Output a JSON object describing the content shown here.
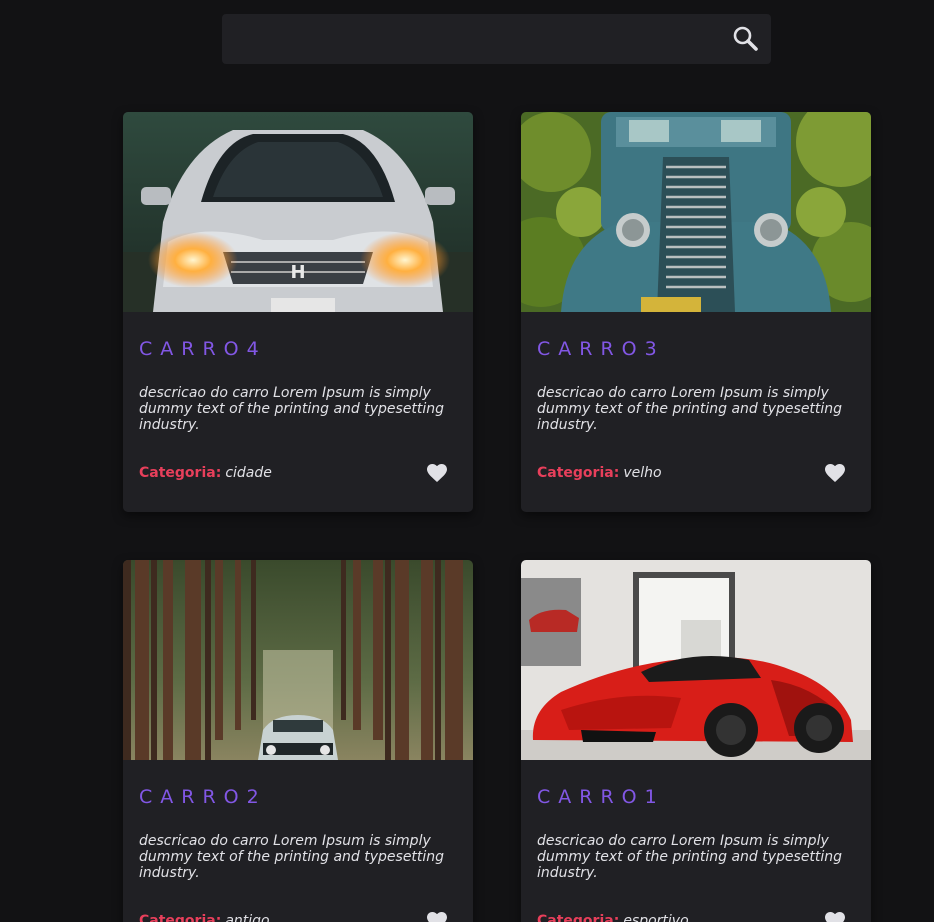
{
  "search": {
    "value": "",
    "placeholder": "",
    "icon": "search-icon"
  },
  "cars": [
    {
      "title": "CARRO4",
      "description": "descricao do carro Lorem Ipsum is simply dummy text of the printing and typesetting industry.",
      "category_label": "Categoria:",
      "category": "cidade",
      "image": "white-honda-headlights",
      "favorite_icon": "heart-icon"
    },
    {
      "title": "CARRO3",
      "description": "descricao do carro Lorem Ipsum is simply dummy text of the printing and typesetting industry.",
      "category_label": "Categoria:",
      "category": "velho",
      "image": "vintage-blue-truck-vineyard",
      "favorite_icon": "heart-icon"
    },
    {
      "title": "CARRO2",
      "description": "descricao do carro Lorem Ipsum is simply dummy text of the printing and typesetting industry.",
      "category_label": "Categoria:",
      "category": "antigo",
      "image": "classic-car-forest",
      "favorite_icon": "heart-icon"
    },
    {
      "title": "CARRO1",
      "description": "descricao do carro Lorem Ipsum is simply dummy text of the printing and typesetting industry.",
      "category_label": "Categoria:",
      "category": "esportivo",
      "image": "red-ferrari-showroom",
      "favorite_icon": "heart-icon"
    }
  ],
  "colors": {
    "background": "#121214",
    "surface": "#202024",
    "title": "#8257e5",
    "category_label": "#e83f5b",
    "text": "#e1e1e6"
  }
}
